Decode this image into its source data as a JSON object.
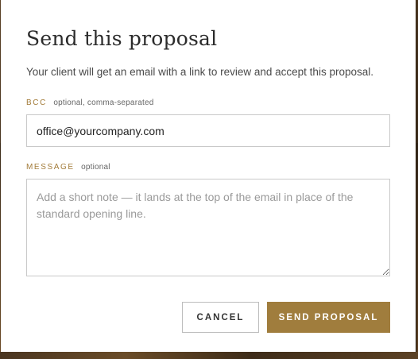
{
  "modal": {
    "title": "Send this proposal",
    "description": "Your client will get an email with a link to review and accept this proposal."
  },
  "bcc": {
    "label": "BCC",
    "hint": "optional, comma-separated",
    "value": "office@yourcompany.com"
  },
  "message": {
    "label": "MESSAGE",
    "hint": "optional",
    "placeholder": "Add a short note — it lands at the top of the email in place of the standard opening line.",
    "value": ""
  },
  "actions": {
    "cancel_label": "CANCEL",
    "send_label": "SEND PROPOSAL"
  },
  "colors": {
    "accent": "#a07d3d",
    "label_accent": "#a37c3a",
    "backdrop": "#3b2a18"
  }
}
